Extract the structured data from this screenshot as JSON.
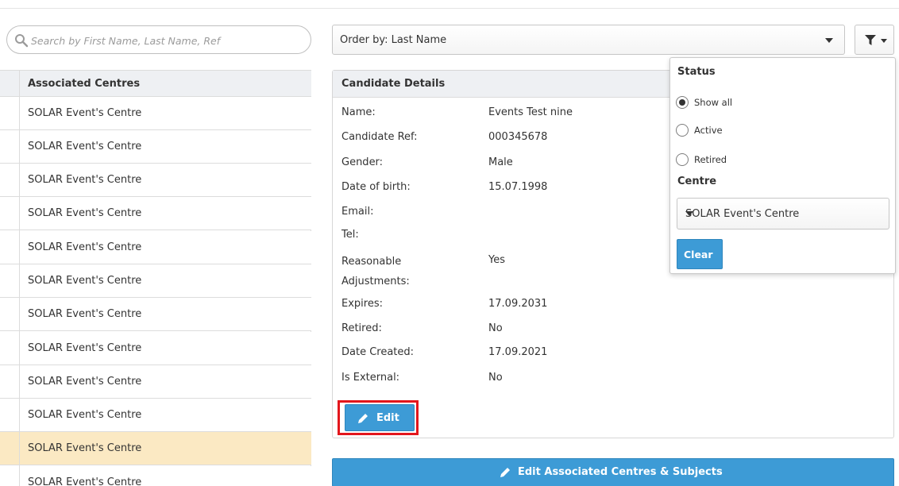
{
  "search": {
    "placeholder": "Search by First Name, Last Name, Ref"
  },
  "order": {
    "label": "Order by: Last Name"
  },
  "centres": {
    "header": "Associated Centres",
    "rows": [
      "SOLAR Event's Centre",
      "SOLAR Event's Centre",
      "SOLAR Event's Centre",
      "SOLAR Event's Centre",
      "SOLAR Event's Centre",
      "SOLAR Event's Centre",
      "SOLAR Event's Centre",
      "SOLAR Event's Centre",
      "SOLAR Event's Centre",
      "SOLAR Event's Centre",
      "SOLAR Event's Centre",
      "SOLAR Event's Centre"
    ],
    "selected_index": 10
  },
  "details": {
    "header": "Candidate Details",
    "fields": [
      {
        "label": "Name:",
        "value": "Events Test nine"
      },
      {
        "label": "Candidate Ref:",
        "value": "000345678"
      },
      {
        "label": "Gender:",
        "value": "Male"
      },
      {
        "label": "Date of birth:",
        "value": "15.07.1998"
      },
      {
        "label": "Email:",
        "value": ""
      },
      {
        "label": "Tel:",
        "value": ""
      },
      {
        "label": "Reasonable Adjustments:",
        "value": "Yes"
      },
      {
        "label": "Expires:",
        "value": "17.09.2031"
      },
      {
        "label": "Retired:",
        "value": "No"
      },
      {
        "label": "Date Created:",
        "value": "17.09.2021"
      },
      {
        "label": "Is External:",
        "value": "No"
      }
    ],
    "edit_label": "Edit"
  },
  "edit_associated_label": "Edit Associated Centres & Subjects",
  "filter": {
    "status_title": "Status",
    "options": [
      {
        "label": "Show all",
        "checked": true
      },
      {
        "label": "Active",
        "checked": false
      },
      {
        "label": "Retired",
        "checked": false
      }
    ],
    "centre_title": "Centre",
    "centre_value": "SOLAR Event's Centre",
    "clear_label": "Clear"
  },
  "colors": {
    "primary_button": "#3d9bd6",
    "selected_row": "#fbe9c3",
    "highlight_outline": "#e3161c"
  }
}
